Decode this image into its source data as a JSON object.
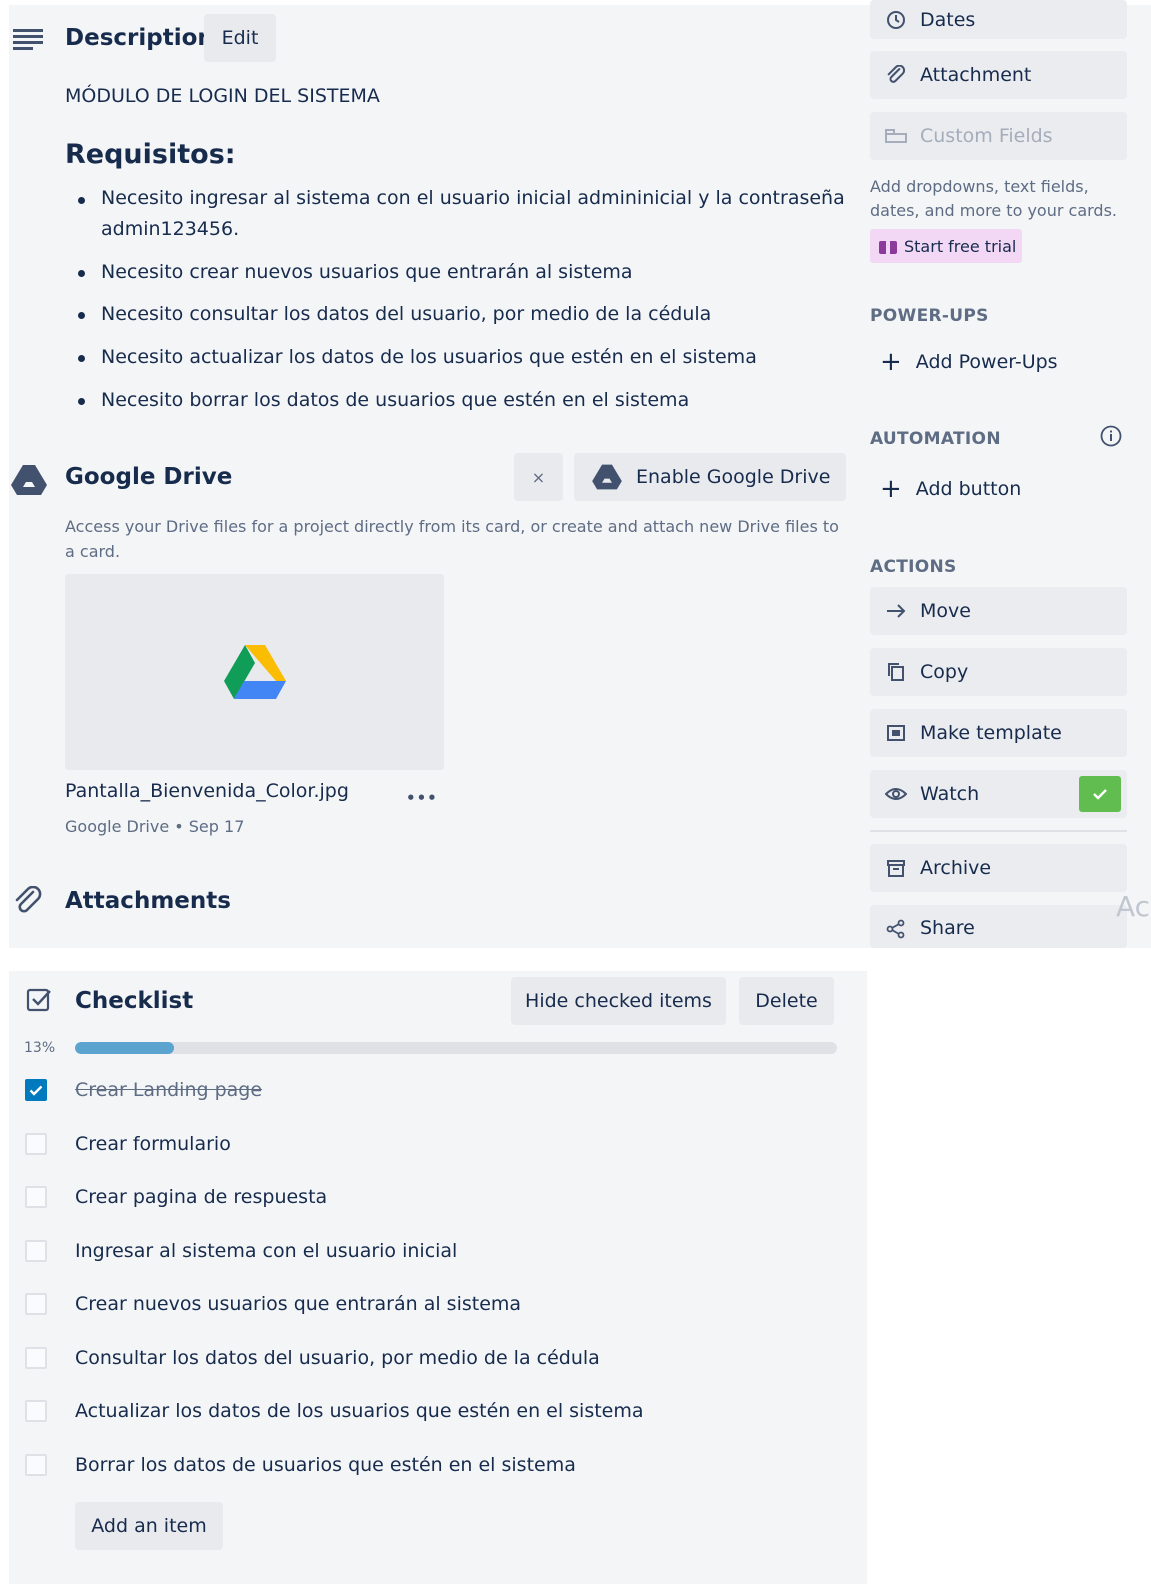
{
  "description": {
    "title": "Description",
    "edit_label": "Edit",
    "module": "MÓDULO DE LOGIN DEL SISTEMA",
    "heading": "Requisitos:",
    "requirements": [
      "Necesito ingresar al sistema con el usuario inicial admininicial y la contraseña",
      "admin123456.",
      "Necesito crear nuevos usuarios que entrarán al sistema",
      "Necesito consultar los datos del usuario, por medio de la cédula",
      "Necesito actualizar los datos de los usuarios que estén en el sistema",
      "Necesito borrar los datos de usuarios que estén en el sistema"
    ]
  },
  "google_drive": {
    "title": "Google Drive",
    "close_label": "×",
    "enable_label": "Enable Google Drive",
    "description_line1": "Access your Drive files for a project directly from its card, or create and attach new Drive files to",
    "description_line2": "a card.",
    "file_name": "Pantalla_Bienvenida_Color.jpg",
    "file_meta": "Google Drive • Sep 17",
    "more_label": "•••"
  },
  "attachments": {
    "title": "Attachments"
  },
  "sidebar": {
    "dates_label": "Dates",
    "attachment_label": "Attachment",
    "custom_fields_label": "Custom Fields",
    "custom_fields_desc_line1": "Add dropdowns, text fields,",
    "custom_fields_desc_line2": "dates, and more to your cards.",
    "trial_label": "Start free trial",
    "powerups_heading": "POWER-UPS",
    "add_powerups_label": "Add Power-Ups",
    "automation_heading": "AUTOMATION",
    "add_button_label": "Add button",
    "actions_heading": "ACTIONS",
    "move_label": "Move",
    "copy_label": "Copy",
    "template_label": "Make template",
    "watch_label": "Watch",
    "archive_label": "Archive",
    "share_label": "Share",
    "cutoff_text": "Ac"
  },
  "checklist": {
    "title": "Checklist",
    "hide_label": "Hide checked items",
    "delete_label": "Delete",
    "progress_text": "13%",
    "progress": 0.13,
    "items": [
      {
        "text": "Crear Landing page",
        "checked": true
      },
      {
        "text": "Crear formulario",
        "checked": false
      },
      {
        "text": "Crear pagina de respuesta",
        "checked": false
      },
      {
        "text": "Ingresar al sistema con el usuario inicial",
        "checked": false
      },
      {
        "text": "Crear nuevos usuarios que entrarán al sistema",
        "checked": false
      },
      {
        "text": "Consultar los datos del usuario, por medio de la cédula",
        "checked": false
      },
      {
        "text": "Actualizar los datos de los usuarios que estén en el sistema",
        "checked": false
      },
      {
        "text": "Borrar los datos de usuarios que estén en el sistema",
        "checked": false
      }
    ],
    "add_item_label": "Add an item"
  },
  "colors": {
    "progress_fill": "#5ba4cf",
    "progress_track": "#dfe1e6",
    "watch_check": "#61bd4f",
    "trial_bg": "#f3d8f6",
    "checked_box": "#0079bf"
  }
}
